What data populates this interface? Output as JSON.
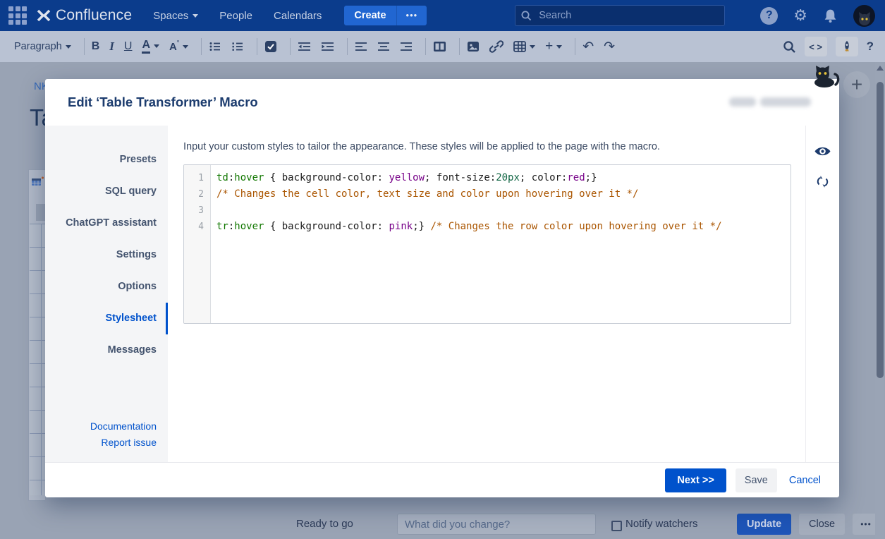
{
  "topnav": {
    "brand": "Confluence",
    "items": [
      {
        "label": "Spaces"
      },
      {
        "label": "People"
      },
      {
        "label": "Calendars"
      }
    ],
    "create_label": "Create",
    "more_label": "•••",
    "search_placeholder": "Search",
    "help_label": "?"
  },
  "toolbar": {
    "paragraph_label": "Paragraph",
    "bold_label": "B",
    "italic_label": "I",
    "underline_label": "U",
    "text_color_label": "A",
    "more_styles_label": "A",
    "more_styles_mark": "°",
    "plus_label": "+",
    "undo_glyph": "↶",
    "redo_glyph": "↷",
    "source_label": "< >",
    "help_label": "?"
  },
  "page_background": {
    "breadcrumb": "NK",
    "title_partial": "Ta"
  },
  "modal": {
    "title": "Edit ‘Table Transformer’ Macro",
    "sidebar": {
      "items": [
        {
          "label": "Presets",
          "active": false
        },
        {
          "label": "SQL query",
          "active": false
        },
        {
          "label": "ChatGPT assistant",
          "active": false
        },
        {
          "label": "Settings",
          "active": false
        },
        {
          "label": "Options",
          "active": false
        },
        {
          "label": "Stylesheet",
          "active": true
        },
        {
          "label": "Messages",
          "active": false
        }
      ],
      "links": [
        {
          "label": "Documentation"
        },
        {
          "label": "Report issue"
        }
      ]
    },
    "description": "Input your custom styles to tailor the appearance. These styles will be applied to the page with the macro.",
    "code": {
      "language": "css",
      "lines": [
        {
          "number": "1",
          "tokens": [
            {
              "t": "td",
              "c": "tag"
            },
            {
              "t": ":",
              "c": "plain"
            },
            {
              "t": "hover",
              "c": "tag"
            },
            {
              "t": " { background-color: ",
              "c": "plain"
            },
            {
              "t": "yellow",
              "c": "keyword"
            },
            {
              "t": "; font-size:",
              "c": "plain"
            },
            {
              "t": "20px",
              "c": "number"
            },
            {
              "t": "; color:",
              "c": "plain"
            },
            {
              "t": "red",
              "c": "keyword"
            },
            {
              "t": ";}",
              "c": "plain"
            }
          ]
        },
        {
          "number": "2",
          "tokens": [
            {
              "t": "/* Changes the cell color, text size and color upon hovering over it */",
              "c": "comment"
            }
          ]
        },
        {
          "number": "3",
          "tokens": []
        },
        {
          "number": "4",
          "tokens": [
            {
              "t": "tr",
              "c": "tag"
            },
            {
              "t": ":",
              "c": "plain"
            },
            {
              "t": "hover",
              "c": "tag"
            },
            {
              "t": " { background-color: ",
              "c": "plain"
            },
            {
              "t": "pink",
              "c": "keyword"
            },
            {
              "t": ";} ",
              "c": "plain"
            },
            {
              "t": "/* Changes the row color upon hovering over it */",
              "c": "comment"
            }
          ]
        }
      ]
    },
    "footer": {
      "next_label": "Next >>",
      "save_label": "Save",
      "cancel_label": "Cancel"
    }
  },
  "bottombar": {
    "status": "Ready to go",
    "comment_placeholder": "What did you change?",
    "notify_label": "Notify watchers",
    "update_label": "Update",
    "close_label": "Close",
    "more_label": "•••"
  },
  "colors": {
    "accent": "#0052cc",
    "topnav": "#0b3c8c",
    "code_tag": "#117700",
    "code_keyword": "#770088",
    "code_number": "#116644",
    "code_comment": "#aa5500"
  }
}
